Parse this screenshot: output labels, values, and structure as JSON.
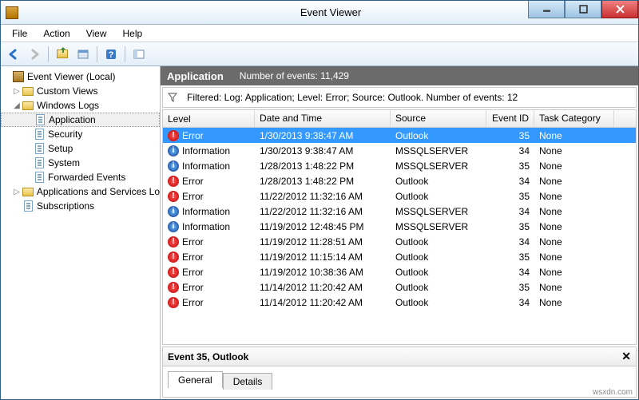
{
  "window_title": "Event Viewer",
  "menu": [
    "File",
    "Action",
    "View",
    "Help"
  ],
  "tree": {
    "root": "Event Viewer (Local)",
    "custom_views": "Custom Views",
    "windows_logs": "Windows Logs",
    "wl_children": [
      "Application",
      "Security",
      "Setup",
      "System",
      "Forwarded Events"
    ],
    "apps_services": "Applications and Services Lo",
    "subscriptions": "Subscriptions"
  },
  "header": {
    "title": "Application",
    "count_label": "Number of events: 11,429"
  },
  "filter_text": "Filtered: Log: Application; Level: Error; Source: Outlook. Number of events: 12",
  "columns": {
    "level": "Level",
    "date": "Date and Time",
    "source": "Source",
    "eid": "Event ID",
    "cat": "Task Category"
  },
  "events": [
    {
      "level": "Error",
      "icon": "err",
      "date": "1/30/2013 9:38:47 AM",
      "source": "Outlook",
      "eid": "35",
      "cat": "None",
      "sel": true
    },
    {
      "level": "Information",
      "icon": "info",
      "date": "1/30/2013 9:38:47 AM",
      "source": "MSSQLSERVER",
      "eid": "34",
      "cat": "None"
    },
    {
      "level": "Information",
      "icon": "info",
      "date": "1/28/2013 1:48:22 PM",
      "source": "MSSQLSERVER",
      "eid": "35",
      "cat": "None"
    },
    {
      "level": "Error",
      "icon": "err",
      "date": "1/28/2013 1:48:22 PM",
      "source": "Outlook",
      "eid": "34",
      "cat": "None"
    },
    {
      "level": "Error",
      "icon": "err",
      "date": "11/22/2012 11:32:16 AM",
      "source": "Outlook",
      "eid": "35",
      "cat": "None"
    },
    {
      "level": "Information",
      "icon": "info",
      "date": "11/22/2012 11:32:16 AM",
      "source": "MSSQLSERVER",
      "eid": "34",
      "cat": "None"
    },
    {
      "level": "Information",
      "icon": "info",
      "date": "11/19/2012 12:48:45 PM",
      "source": "MSSQLSERVER",
      "eid": "35",
      "cat": "None"
    },
    {
      "level": "Error",
      "icon": "err",
      "date": "11/19/2012 11:28:51 AM",
      "source": "Outlook",
      "eid": "34",
      "cat": "None"
    },
    {
      "level": "Error",
      "icon": "err",
      "date": "11/19/2012 11:15:14 AM",
      "source": "Outlook",
      "eid": "35",
      "cat": "None"
    },
    {
      "level": "Error",
      "icon": "err",
      "date": "11/19/2012 10:38:36 AM",
      "source": "Outlook",
      "eid": "34",
      "cat": "None"
    },
    {
      "level": "Error",
      "icon": "err",
      "date": "11/14/2012 11:20:42 AM",
      "source": "Outlook",
      "eid": "35",
      "cat": "None"
    },
    {
      "level": "Error",
      "icon": "err",
      "date": "11/14/2012 11:20:42 AM",
      "source": "Outlook",
      "eid": "34",
      "cat": "None"
    }
  ],
  "detail": {
    "title": "Event 35, Outlook",
    "tabs": [
      "General",
      "Details"
    ]
  },
  "watermark": "wsxdn.com"
}
